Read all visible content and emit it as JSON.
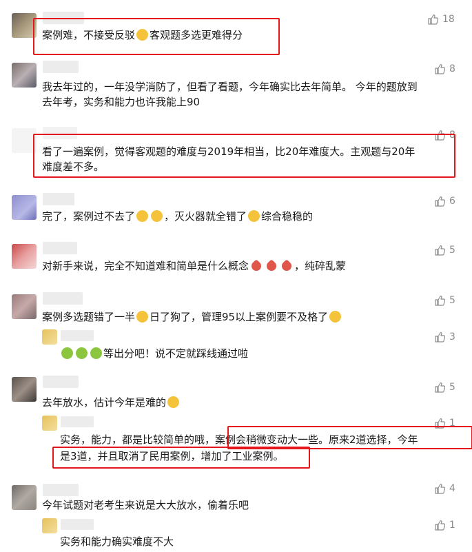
{
  "comments": [
    {
      "text": "案例难，不接受反驳",
      "text_b": "客观题多选更难得分",
      "likes": "18"
    },
    {
      "line1": "我去年过的，一年没学消防了，但看了看题，今年确实比去年简单。 今年的题放到",
      "line2": "去年考，实务和能力也许我能上90",
      "likes": "8"
    },
    {
      "line1": "看了一遍案例，觉得客观题的难度与2019年相当，比20年难度大。主观题与20年",
      "line2": "难度差不多。",
      "likes": "8"
    },
    {
      "text_a": "完了，案例过不去了",
      "text_b": "，灭火器就全错了",
      "text_c": "综合稳稳的",
      "likes": "6"
    },
    {
      "text_a": "对新手来说，完全不知道难和简单是什么概念",
      "text_b": "，纯碎乱蒙",
      "likes": "5"
    },
    {
      "text_a": "案例多选题错了一半",
      "text_b": "日了狗了，管理95以上案例要不及格了",
      "likes": "5",
      "reply": {
        "text": "等出分吧！说不定就踩线通过啦",
        "likes": "3"
      }
    },
    {
      "text": "去年放水，估计今年是难的",
      "likes": "5",
      "reply": {
        "line1": "实务，能力，都是比较简单的哦，案例会稍微变动大一些。原来2道选择，今年",
        "line2": "是3道，并且取消了民用案例，增加了工业案例。",
        "likes": "1"
      }
    },
    {
      "text": "今年试题对老考生来说是大大放水，偷着乐吧",
      "likes": "4",
      "reply": {
        "text": "实务和能力确实难度不大",
        "likes": "1"
      }
    }
  ],
  "colors": {
    "highlight": "#e5171c",
    "like": "#8c8c8c"
  }
}
